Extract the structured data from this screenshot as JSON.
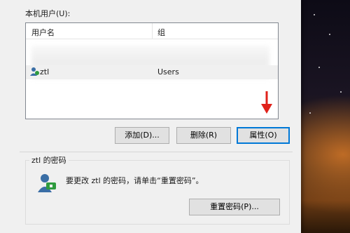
{
  "dialog": {
    "users_label": "本机用户(U):",
    "columns": {
      "user": "用户名",
      "group": "组"
    },
    "users": [
      {
        "name": "ztl",
        "group": "Users"
      }
    ],
    "buttons": {
      "add": "添加(D)...",
      "delete": "删除(R)",
      "properties": "属性(O)"
    },
    "password_group": {
      "title": "ztl 的密码",
      "text": "要更改 ztl 的密码，请单击“重置密码”。",
      "reset_button": "重置密码(P)..."
    },
    "annotation_arrow_color": "#e0221b"
  }
}
